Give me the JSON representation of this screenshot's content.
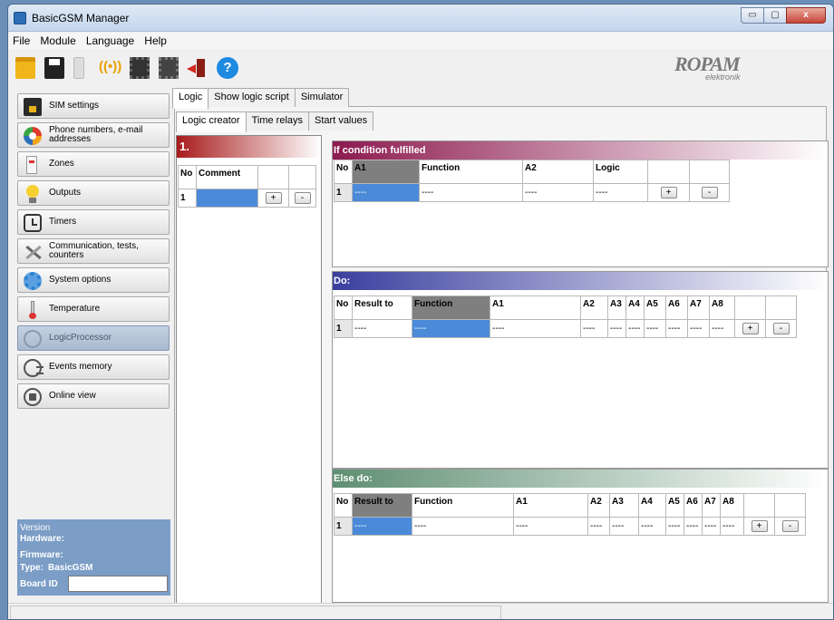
{
  "window": {
    "title": "BasicGSM Manager"
  },
  "menu": [
    "File",
    "Module",
    "Language",
    "Help"
  ],
  "toolbar": [
    "folder-icon",
    "save-icon",
    "usb-icon",
    "radio-icon",
    "chip-read-icon",
    "chip-write-icon",
    "exit-icon",
    "help-icon"
  ],
  "logo": {
    "brand": "ROPAM",
    "sub": "elektronik"
  },
  "sidebar": {
    "items": [
      {
        "label": "SIM settings",
        "icon": "sim-icon"
      },
      {
        "label": "Phone numbers, e-mail addresses",
        "icon": "phone-icon"
      },
      {
        "label": "Zones",
        "icon": "zones-icon"
      },
      {
        "label": "Outputs",
        "icon": "bulb-icon"
      },
      {
        "label": "Timers",
        "icon": "clock-icon"
      },
      {
        "label": "Communication, tests, counters",
        "icon": "tools-icon"
      },
      {
        "label": "System options",
        "icon": "gear-icon"
      },
      {
        "label": "Temperature",
        "icon": "thermometer-icon"
      },
      {
        "label": "LogicProcessor",
        "icon": "logic-icon"
      },
      {
        "label": "Events memory",
        "icon": "events-icon"
      },
      {
        "label": "Online view",
        "icon": "online-icon"
      }
    ],
    "active": "LogicProcessor",
    "version": {
      "title": "Version",
      "hardware_label": "Hardware:",
      "firmware_label": "Firmware:",
      "type_label": "Type:",
      "type_value": "BasicGSM",
      "board_label": "Board ID"
    }
  },
  "tabs": [
    "Logic",
    "Show logic script",
    "Simulator"
  ],
  "subtabs": [
    "Logic creator",
    "Time relays",
    "Start values"
  ],
  "logic_list": {
    "title": "1.",
    "headers": [
      "No",
      "Comment"
    ],
    "rows": [
      {
        "no": "1",
        "comment": ""
      }
    ]
  },
  "if_section": {
    "title": "If condition fulfilled",
    "headers": [
      "No",
      "A1",
      "Function",
      "A2",
      "Logic"
    ],
    "row": [
      "1",
      "----",
      "----",
      "----",
      "----"
    ]
  },
  "do_section": {
    "title": "Do:",
    "headers": [
      "No",
      "Result to",
      "Function",
      "A1",
      "A2",
      "A3",
      "A4",
      "A5",
      "A6",
      "A7",
      "A8"
    ],
    "row": [
      "1",
      "----",
      "----",
      "----",
      "----",
      "----",
      "----",
      "----",
      "----",
      "----",
      "----"
    ]
  },
  "else_section": {
    "title": "Else do:",
    "headers": [
      "No",
      "Result to",
      "Function",
      "A1",
      "A2",
      "A3",
      "A4",
      "A5",
      "A6",
      "A7",
      "A8"
    ],
    "row": [
      "1",
      "----",
      "----",
      "----",
      "----",
      "----",
      "----",
      "----",
      "----",
      "----",
      "----"
    ]
  },
  "buttons": {
    "plus": "+",
    "minus": "-"
  },
  "window_controls": {
    "minimize": "▭",
    "maximize": "▢",
    "close": "x"
  },
  "colors": {
    "if_header": "#8c1a4f",
    "do_header": "#3a3f9e",
    "else_header": "#5f8f72",
    "logic_header": "#a81c1c",
    "version_bg": "#7b9dc6"
  }
}
